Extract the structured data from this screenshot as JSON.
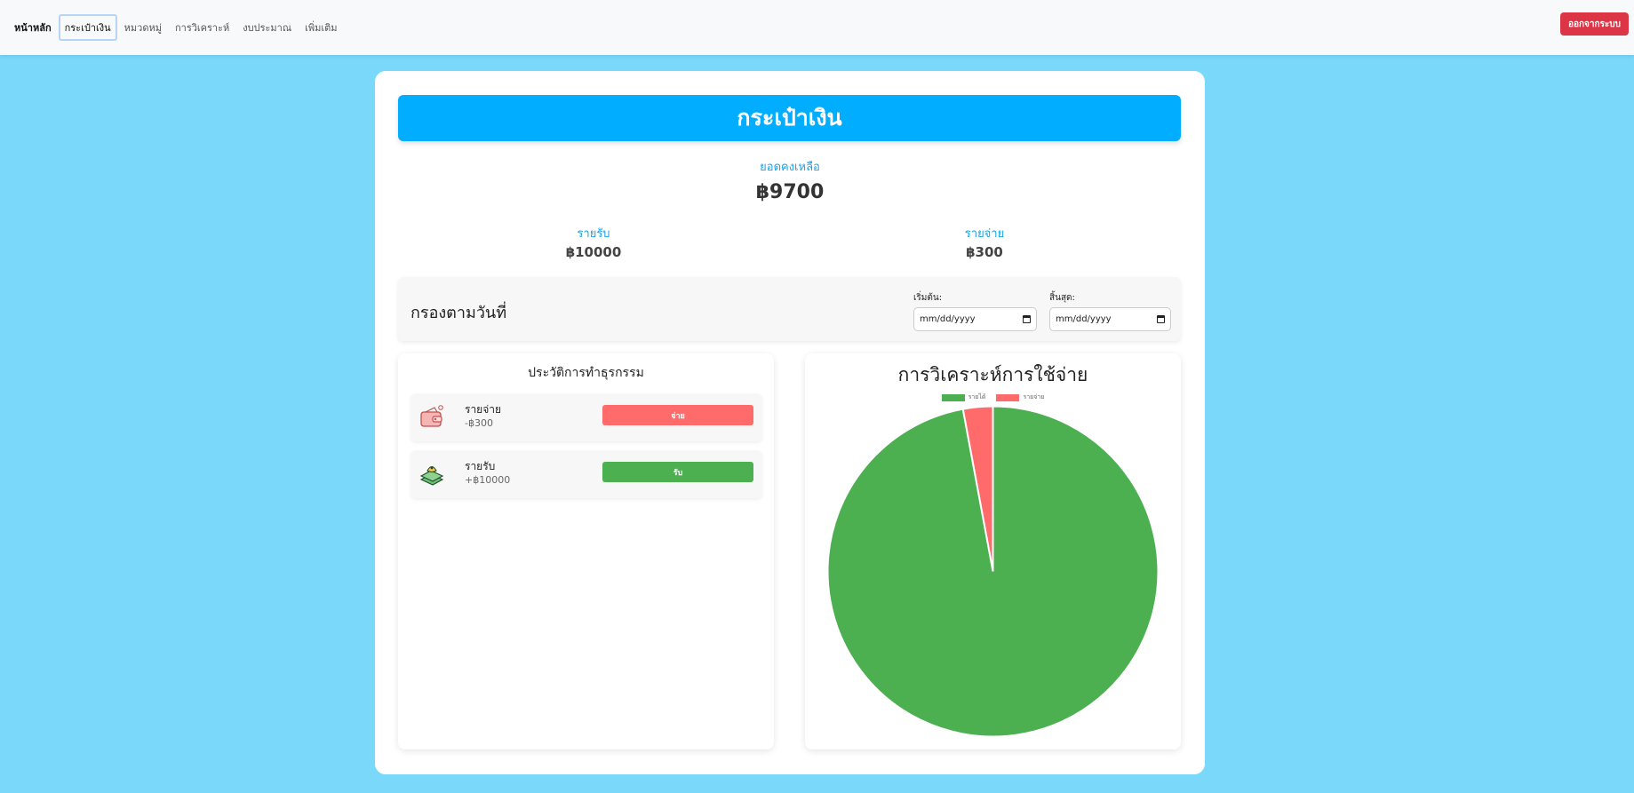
{
  "nav": {
    "brand": "หน้าหลัก",
    "items": [
      "กระเป๋าเงิน",
      "หมวดหมู่",
      "การวิเคราะห์",
      "งบประมาณ",
      "เพิ่มเติม"
    ],
    "active_index": 0,
    "logout_label": "ออกจากระบบ"
  },
  "wallet": {
    "title": "กระเป๋าเงิน",
    "balance_label": "ยอดคงเหลือ",
    "balance_value": "฿9700",
    "income_label": "รายรับ",
    "income_value": "฿10000",
    "expense_label": "รายจ่าย",
    "expense_value": "฿300"
  },
  "filter": {
    "title": "กรองตามวันที่",
    "start_label": "เริ่มต้น:",
    "start_placeholder": "mm/dd/yyyy",
    "end_label": "สิ้นสุด:",
    "end_placeholder": "mm/dd/yyyy"
  },
  "history": {
    "title": "ประวัติการทำธุรกรรม",
    "transactions": [
      {
        "name": "รายจ่าย",
        "amount": "-฿300",
        "button": "จ่าย",
        "color": "#ff6b6b",
        "icon": "wallet-icon"
      },
      {
        "name": "รายรับ",
        "amount": "+฿10000",
        "button": "รับ",
        "color": "#4caf50",
        "icon": "money-icon"
      }
    ]
  },
  "chart_data": {
    "type": "pie",
    "title": "การวิเคราะห์การใช้จ่าย",
    "categories": [
      "รายได้",
      "รายจ่าย"
    ],
    "values": [
      10000,
      300
    ],
    "colors": [
      "#4caf50",
      "#ff6b6b"
    ],
    "legend": "top"
  }
}
